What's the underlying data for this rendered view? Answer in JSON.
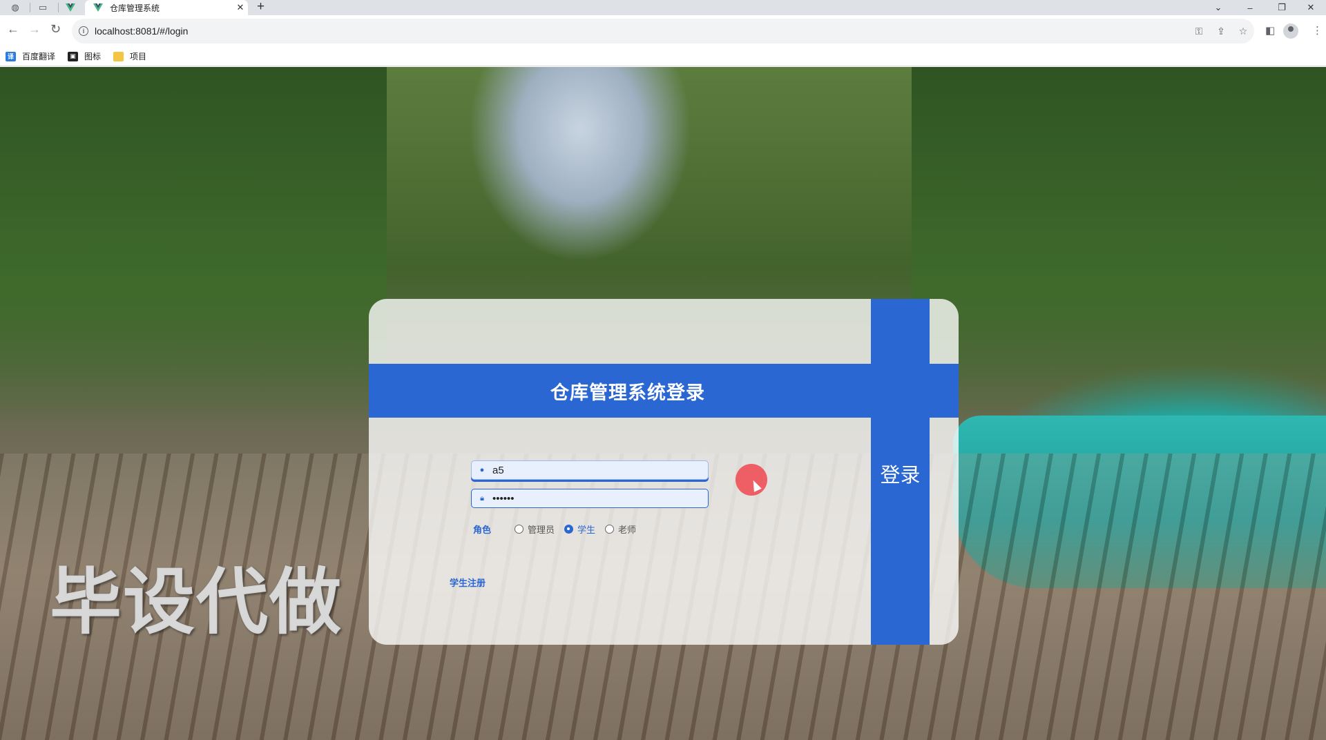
{
  "browser": {
    "tab_title": "仓库管理系统",
    "new_tab": "+",
    "url": "localhost:8081/#/login",
    "bookmarks": [
      {
        "label": "百度翻译",
        "icon": "translate-icon",
        "color": "#2b7be5"
      },
      {
        "label": "图标",
        "icon": "image-icon",
        "color": "#222222"
      },
      {
        "label": "项目",
        "icon": "folder-icon",
        "color": "#f4c542"
      }
    ]
  },
  "login": {
    "title": "仓库管理系统登录",
    "username_value": "a5",
    "password_value": "••••••",
    "role_label": "角色",
    "roles": [
      {
        "label": "管理员",
        "checked": false
      },
      {
        "label": "学生",
        "checked": true
      },
      {
        "label": "老师",
        "checked": false
      }
    ],
    "register_link": "学生注册",
    "submit_label": "登录",
    "accent_color": "#2a67d2"
  },
  "watermark": "毕设代做"
}
